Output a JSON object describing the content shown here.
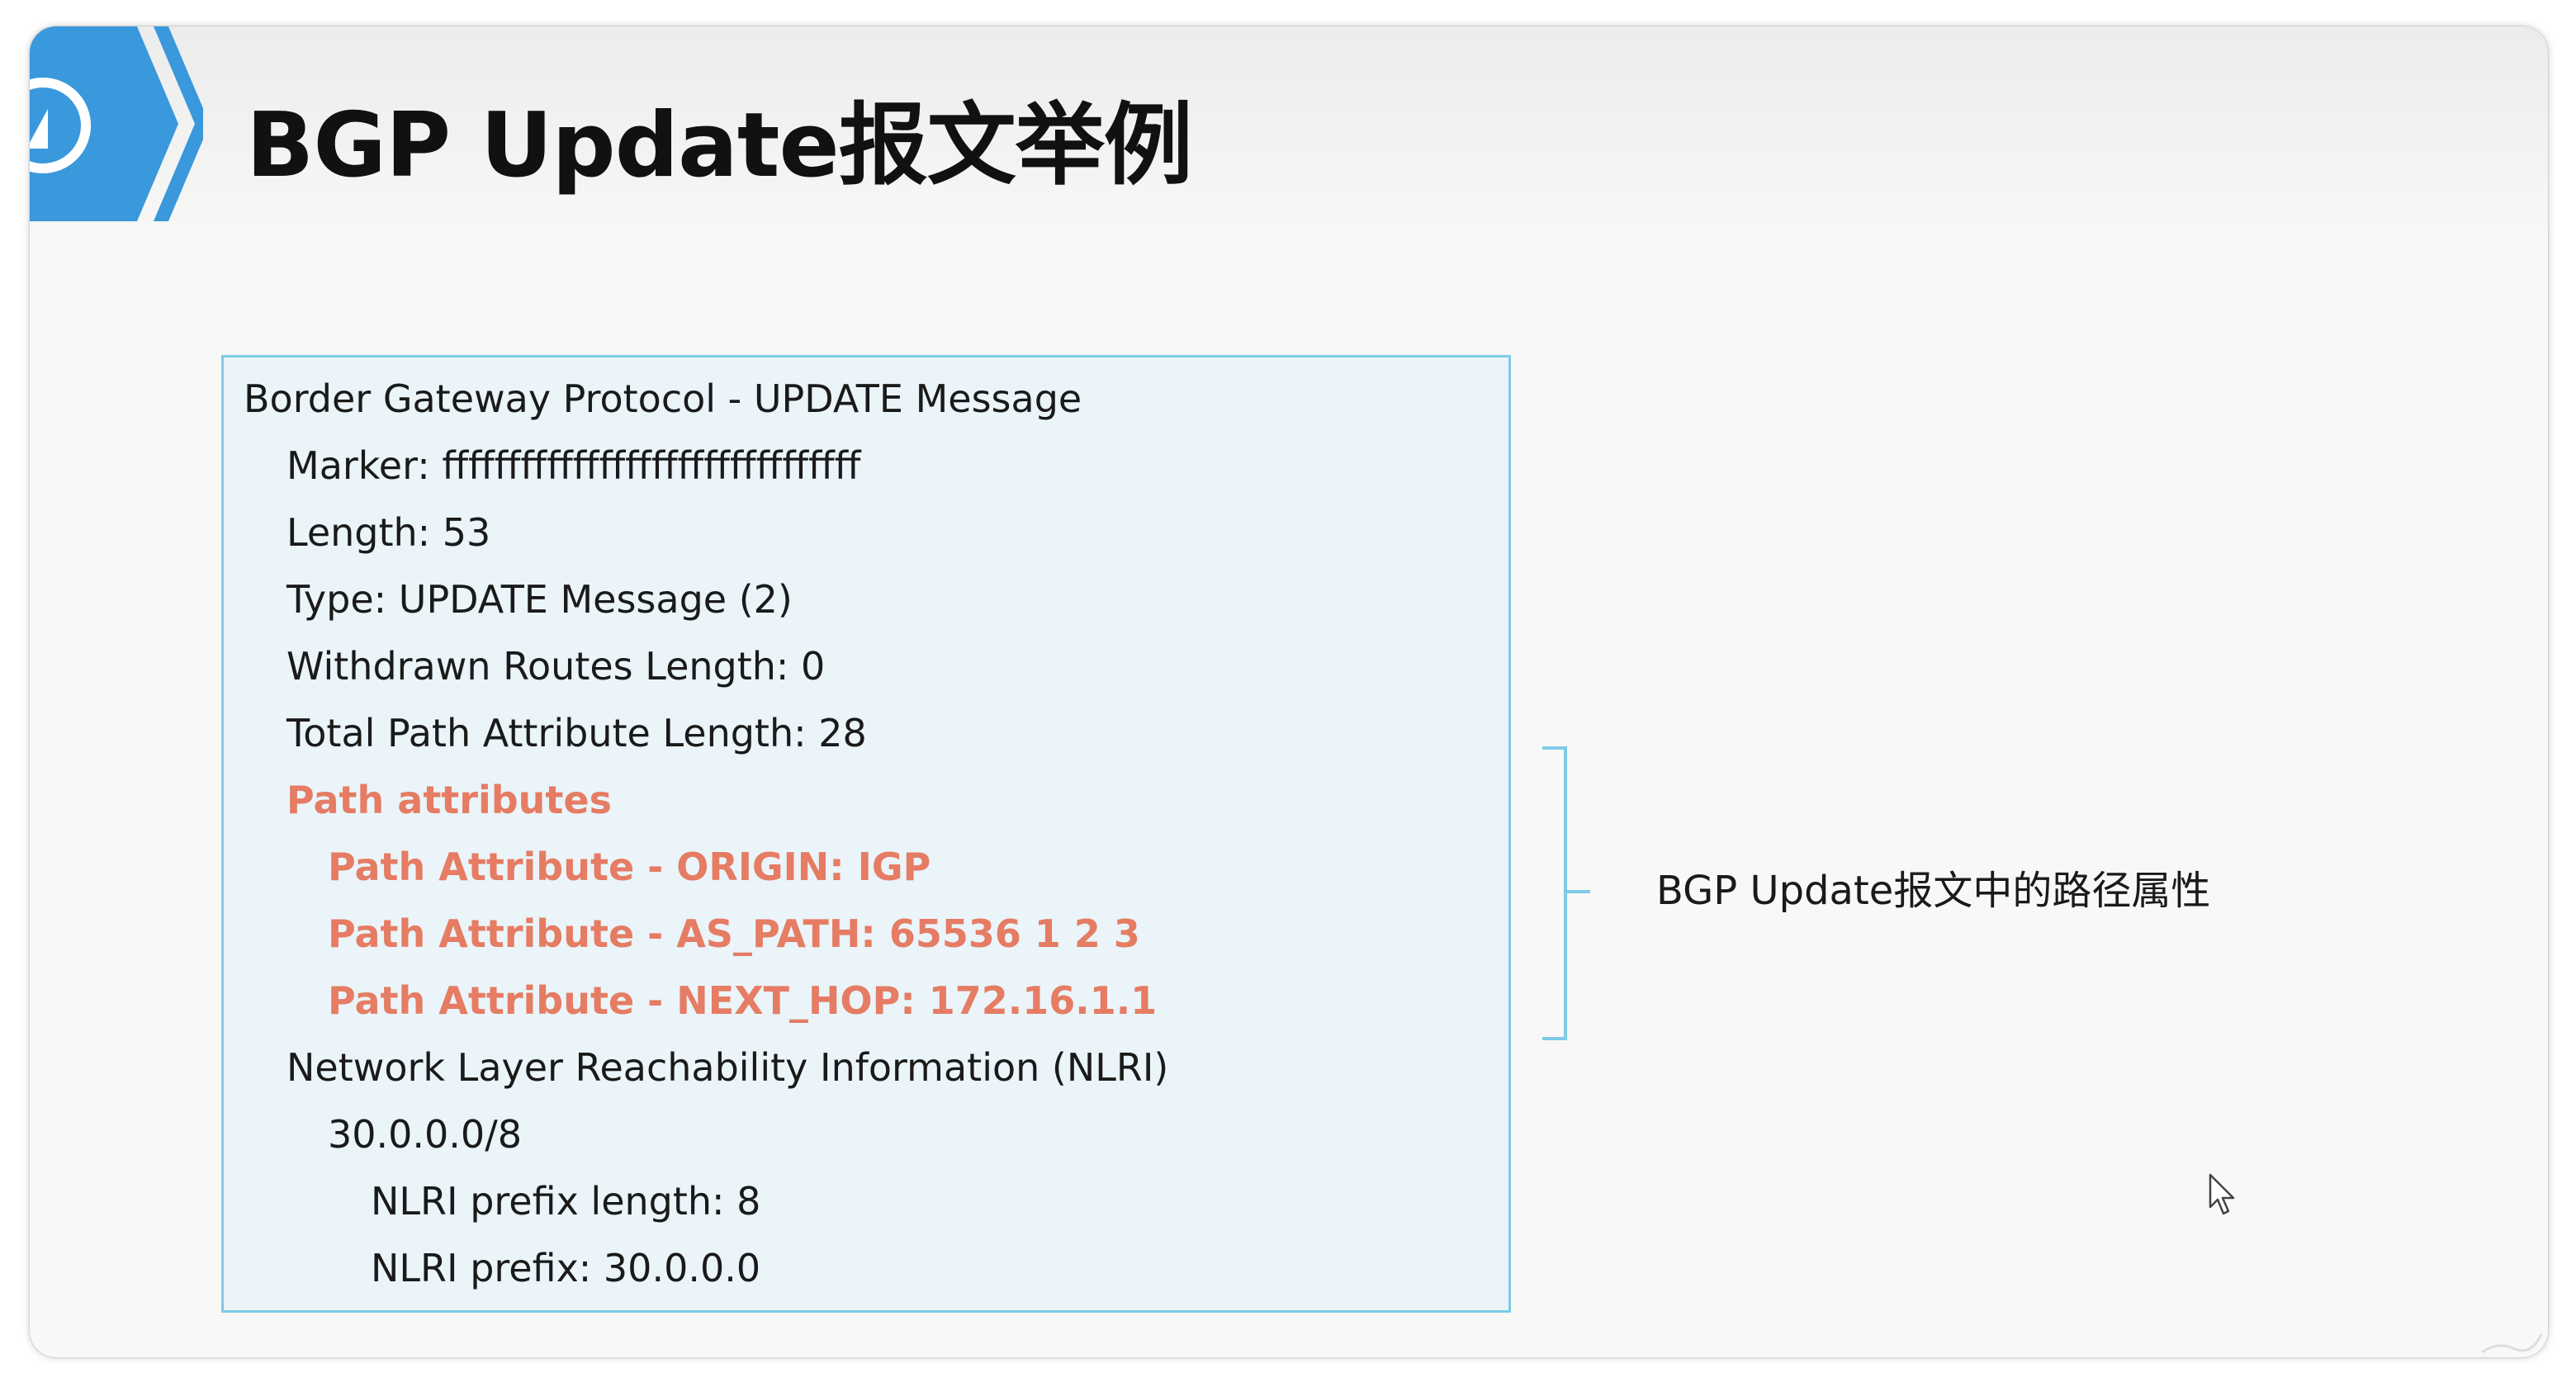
{
  "slide": {
    "title": "BGP Update报文举例"
  },
  "packet": {
    "lines": [
      "Border Gateway Protocol - UPDATE Message",
      "Marker: ffffffffffffffffffffffffffffffff",
      "Length: 53",
      "Type: UPDATE Message (2)",
      "Withdrawn Routes Length: 0",
      "Total Path Attribute Length: 28",
      "Path attributes",
      "Path Attribute - ORIGIN: IGP",
      "Path Attribute - AS_PATH: 65536 1 2 3",
      "Path Attribute - NEXT_HOP: 172.16.1.1",
      "Network Layer Reachability Information (NLRI)",
      "30.0.0.0/8",
      "NLRI prefix length: 8",
      "NLRI prefix: 30.0.0.0"
    ]
  },
  "annotation": {
    "text": "BGP Update报文中的路径属性"
  },
  "colors": {
    "highlight": "#e57c63",
    "box_border": "#7ecbe8",
    "box_fill": "#eaf4f9",
    "logo_blue": "#3a98dc"
  },
  "icons": {
    "logo": "chevron-logo-icon",
    "cursor": "mouse-pointer-icon"
  }
}
